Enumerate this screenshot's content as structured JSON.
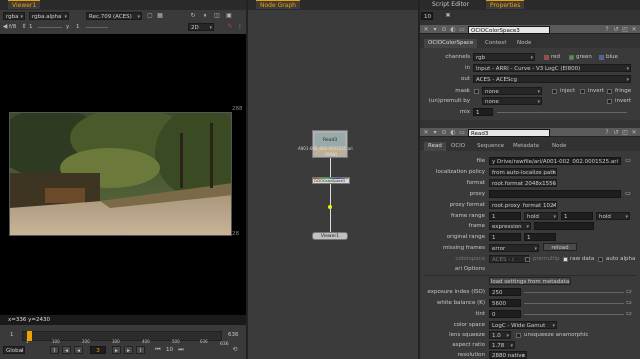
{
  "viewer": {
    "tab": "Viewer1",
    "channels": "rgba",
    "alpha": "rgba.alpha",
    "colorspace": "Rec.709 (ACES)",
    "fstop": "f/8",
    "gain": "1",
    "y_label": "y",
    "gamma": "1",
    "view_mode": "2D",
    "res_right": "288",
    "res_bottom": "28",
    "coords": "x=336 y=2430",
    "frame_start": "1",
    "frame_ticks": [
      "1",
      "100",
      "200",
      "300",
      "400",
      "500",
      "636"
    ],
    "frame_end": "636",
    "frame_end_below": "636",
    "global": "Global",
    "current_frame": "3",
    "step": "10"
  },
  "nodegraph": {
    "tab": "Node Graph",
    "read_label": "Read3",
    "read_file": "A001-002_002.0001525.ari",
    "read_sub": "(RAW)",
    "ocio_label": "OCIOColorSpace3",
    "viewer_label": "Viewer1"
  },
  "right_tabs": {
    "script": "Script Editor",
    "props": "Properties"
  },
  "props_bar": {
    "count": "10"
  },
  "ocio": {
    "title": "OCIOColorSpace3",
    "tabs": [
      "OCIOColorSpace",
      "Context",
      "Node"
    ],
    "channels_label": "channels",
    "channels": "rgb",
    "red": "red",
    "green": "green",
    "blue": "blue",
    "in_label": "in",
    "in": "Input - ARRI - Curve - V3 LogC (EI800)",
    "out_label": "out",
    "out": "ACES - ACEScg",
    "mask_label": "mask",
    "mask": "none",
    "inject": "inject",
    "invert": "invert",
    "fringe": "fringe",
    "premult_label": "(un)premult by",
    "premult": "none",
    "invert2": "invert",
    "mix_label": "mix",
    "mix": "1"
  },
  "read": {
    "title": "Read3",
    "tabs": [
      "Read",
      "OCIO",
      "Sequence",
      "Metadata",
      "Node"
    ],
    "file_label": "file",
    "file": "y Drive/rawfile/ari/A001-002_002.0001525.ari",
    "localization_label": "localization policy",
    "localization": "from auto-localize path",
    "format_label": "format",
    "format": "root.format 2048x1556",
    "proxy_label": "proxy",
    "proxy_format_label": "proxy format",
    "proxy_format": "root.proxy_format 1024x778",
    "frame_range_label": "frame range",
    "fr_start": "1",
    "fr_start_mode": "hold",
    "fr_end": "1",
    "fr_end_mode": "hold",
    "frame_label": "frame",
    "frame": "expression",
    "orig_range_label": "original range",
    "orig_start": "1",
    "orig_end": "1",
    "missing_label": "missing frames",
    "missing": "error",
    "reload": "reload",
    "colorspace_label": "colorspace",
    "colorspace": "ACES - (  ",
    "premultiplied": "premultip",
    "raw_data": "raw data",
    "auto_alpha": "auto alpha",
    "ari_options": "ari Options",
    "load_settings": "load settings from metadata",
    "exposure_label": "exposure index (ISO)",
    "exposure": "250",
    "wb_label": "white balance (K)",
    "wb": "5600",
    "tint_label": "tint",
    "tint": "0",
    "cs_label": "color space",
    "cs": "LogC - Wide Gamut",
    "lens_label": "lens squeeze",
    "lens": "1.0",
    "unsqueeze": "unsqueeze anamorphic",
    "aspect_label": "aspect ratio",
    "aspect": "1.78",
    "res_label": "resolution",
    "res": "2880 native"
  }
}
